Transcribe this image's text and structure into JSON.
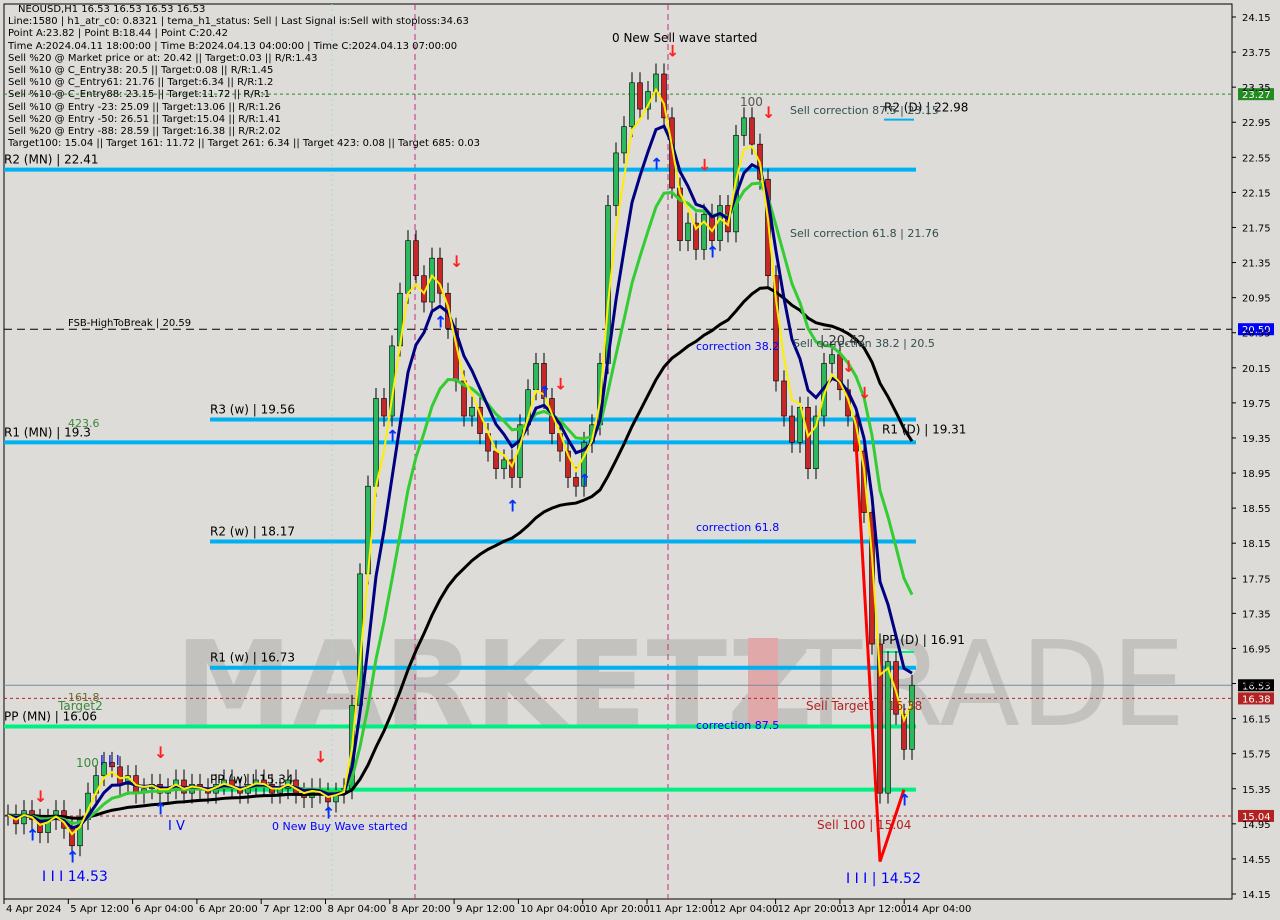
{
  "header": {
    "title": "NEOUSD,H1  16.53 16.53 16.53 16.53",
    "lines": [
      "Line:1580 | h1_atr_c0: 0.8321 | tema_h1_status: Sell | Last Signal is:Sell with stoploss:34.63",
      "Point A:23.82 | Point B:18.44 | Point C:20.42",
      "Time A:2024.04.11 18:00:00 | Time B:2024.04.13 04:00:00 | Time C:2024.04.13 07:00:00",
      "Sell %20 @ Market price or at: 20.42 || Target:0.03 || R/R:1.43",
      "Sell %10 @ C_Entry38: 20.5 || Target:0.08 || R/R:1.45",
      "Sell %10 @ C_Entry61: 21.76 || Target:6.34 || R/R:1.2",
      "Sell %10 @ C_Entry88: 23.15 || Target:11.72 || R/R:1",
      "Sell %10 @ Entry -23: 25.09 || Target:13.06 || R/R:1.26",
      "Sell %20 @ Entry -50: 26.51 || Target:15.04 || R/R:1.41",
      "Sell %20 @ Entry -88: 28.59 || Target:16.38 || R/R:2.02",
      "Target100: 15.04 || Target 161: 11.72 || Target 261: 6.34 || Target 423: 0.08 || Target 685: 0.03"
    ]
  },
  "watermark": {
    "left": "MARKETZ",
    "right": "TRADE"
  },
  "chart_data": {
    "type": "candlestick",
    "symbol": "NEOUSD",
    "timeframe": "H1",
    "ylim": [
      14.15,
      24.15
    ],
    "y_ticks": [
      "24.15",
      "23.75",
      "23.35",
      "22.95",
      "22.55",
      "22.15",
      "21.75",
      "21.35",
      "20.95",
      "20.55",
      "20.15",
      "19.75",
      "19.35",
      "18.95",
      "18.55",
      "18.15",
      "17.75",
      "17.35",
      "16.95",
      "16.55",
      "16.15",
      "15.75",
      "15.35",
      "14.95",
      "14.55",
      "14.15"
    ],
    "x_ticks": [
      "4 Apr 2024",
      "5 Apr 12:00",
      "6 Apr 04:00",
      "6 Apr 20:00",
      "7 Apr 12:00",
      "8 Apr 04:00",
      "8 Apr 20:00",
      "9 Apr 12:00",
      "10 Apr 04:00",
      "10 Apr 20:00",
      "11 Apr 12:00",
      "12 Apr 04:00",
      "12 Apr 20:00",
      "13 Apr 12:00",
      "14 Apr 04:00"
    ],
    "closes": [
      15.05,
      14.95,
      15.1,
      15.0,
      14.85,
      15.0,
      15.1,
      14.9,
      14.7,
      15.0,
      15.3,
      15.5,
      15.65,
      15.6,
      15.4,
      15.5,
      15.3,
      15.35,
      15.4,
      15.3,
      15.35,
      15.45,
      15.3,
      15.4,
      15.35,
      15.3,
      15.4,
      15.45,
      15.35,
      15.3,
      15.4,
      15.45,
      15.4,
      15.3,
      15.35,
      15.45,
      15.3,
      15.25,
      15.35,
      15.3,
      15.2,
      15.3,
      15.35,
      16.3,
      17.8,
      18.8,
      19.8,
      19.6,
      20.4,
      21.0,
      21.6,
      21.2,
      20.9,
      21.4,
      21.0,
      20.6,
      20.0,
      19.6,
      19.7,
      19.4,
      19.2,
      19.0,
      19.1,
      18.9,
      19.5,
      19.9,
      20.2,
      19.8,
      19.4,
      19.2,
      18.9,
      18.8,
      19.3,
      19.5,
      20.2,
      22.0,
      22.6,
      22.9,
      23.4,
      23.1,
      23.3,
      23.5,
      23.0,
      22.2,
      21.6,
      21.8,
      21.5,
      21.9,
      21.6,
      22.0,
      21.7,
      22.8,
      23.0,
      22.7,
      22.3,
      21.2,
      20.0,
      19.6,
      19.3,
      19.7,
      19.0,
      19.6,
      20.2,
      20.3,
      19.9,
      19.6,
      19.2,
      18.5,
      17.0,
      15.3,
      16.8,
      16.2,
      15.8,
      16.53
    ],
    "up_color": "#2eb85c",
    "down_color": "#c62828",
    "ma_colors": {
      "fast": "#ffee00",
      "mid": "#000080",
      "slow": "#33cc33",
      "long": "#000000"
    },
    "levels": [
      {
        "label": "R2 (MN) | 22.41",
        "price": 22.41,
        "color": "#00b0f0"
      },
      {
        "label": "R3 (w) | 19.56",
        "price": 19.56,
        "color": "#00b0f0"
      },
      {
        "label": "R1 (MN) | 19.3",
        "price": 19.3,
        "color": "#00b0f0"
      },
      {
        "label": "R2 (w) | 18.17",
        "price": 18.17,
        "color": "#00b0f0"
      },
      {
        "label": "R1 (w) | 16.73",
        "price": 16.73,
        "color": "#00b0f0"
      },
      {
        "label": "PP (MN) | 16.06",
        "price": 16.06,
        "color": "#00f080"
      },
      {
        "label": "PP (w) | 15.34",
        "price": 15.34,
        "color": "#00f080"
      },
      {
        "label": "PP (D) | 16.91",
        "price": 16.91,
        "color": "#00f080"
      },
      {
        "label": "R1 (D) | 19.31",
        "price": 19.31,
        "color": "#00b0f0"
      },
      {
        "label": "R2 (D) | 22.98",
        "price": 22.98,
        "color": "#00b0f0"
      }
    ],
    "hlines": [
      {
        "label": "FSB-HighToBreak | 20.59",
        "price": 20.59,
        "color": "#000000",
        "axis_label": "20.59",
        "axis_bg": "#0000ff"
      },
      {
        "label": "",
        "price": 23.27,
        "color": "#228b22",
        "axis_label": "23.27",
        "axis_bg": "#228b22"
      },
      {
        "label": "",
        "price": 16.53,
        "color": "#7a8aa0",
        "axis_label": "16.53",
        "axis_bg": "#000000"
      },
      {
        "label": "",
        "price": 16.38,
        "color": "#b22222",
        "axis_label": "16.38",
        "axis_bg": "#b22222"
      },
      {
        "label": "",
        "price": 15.04,
        "color": "#b22222",
        "axis_label": "15.04",
        "axis_bg": "#b22222"
      }
    ],
    "annotations": [
      {
        "text": "0 New Sell wave started",
        "color": "#000000"
      },
      {
        "text": "0 New Buy Wave started",
        "color": "#0000ff"
      },
      {
        "text": "correction 38.2",
        "color": "#0000ff"
      },
      {
        "text": "correction 61.8",
        "color": "#0000ff"
      },
      {
        "text": "correction 87.5",
        "color": "#0000ff"
      },
      {
        "text": "Sell correction 87.5 | 23.15",
        "color": "#2f4f4f"
      },
      {
        "text": "Sell correction 61.8 | 21.76",
        "color": "#2f4f4f"
      },
      {
        "text": "Sell correction 38.2 | 20.5",
        "color": "#2f4f4f"
      },
      {
        "text": "Sell Target1 | 16.38",
        "color": "#b22222"
      },
      {
        "text": "Sell 100 | 15.04",
        "color": "#b22222"
      },
      {
        "text": "I I I | 14.52",
        "color": "#0000ff"
      },
      {
        "text": "I I I 14.53",
        "color": "#0000ff"
      },
      {
        "text": "I V",
        "color": "#0000ff"
      },
      {
        "text": "I I I",
        "color": "#0000ff"
      },
      {
        "text": "100",
        "color": "#3a8a3a"
      },
      {
        "text": "100",
        "color": "#555555"
      },
      {
        "text": "423.6",
        "color": "#3a8a3a"
      },
      {
        "text": "161.8",
        "color": "#6b6b2f"
      },
      {
        "text": "Target2",
        "color": "#3a8a3a"
      },
      {
        "text": "| 20.42",
        "color": "#333333"
      }
    ],
    "signals": [
      {
        "type": "buy",
        "i": 8,
        "price": 14.6
      },
      {
        "type": "buy",
        "i": 3,
        "price": 14.85
      },
      {
        "type": "sell",
        "i": 4,
        "price": 15.2
      },
      {
        "type": "sell",
        "i": 19,
        "price": 15.7
      },
      {
        "type": "buy",
        "i": 19,
        "price": 15.15
      },
      {
        "type": "sell",
        "i": 39,
        "price": 15.65
      },
      {
        "type": "buy",
        "i": 40,
        "price": 15.1
      },
      {
        "type": "buy",
        "i": 48,
        "price": 19.4
      },
      {
        "type": "buy",
        "i": 54,
        "price": 20.7
      },
      {
        "type": "sell",
        "i": 56,
        "price": 21.3
      },
      {
        "type": "buy",
        "i": 63,
        "price": 18.6
      },
      {
        "type": "buy",
        "i": 67,
        "price": 19.9
      },
      {
        "type": "sell",
        "i": 69,
        "price": 19.9
      },
      {
        "type": "buy",
        "i": 72,
        "price": 18.9
      },
      {
        "type": "buy",
        "i": 81,
        "price": 22.5
      },
      {
        "type": "sell",
        "i": 83,
        "price": 23.7
      },
      {
        "type": "sell",
        "i": 87,
        "price": 22.4
      },
      {
        "type": "buy",
        "i": 88,
        "price": 21.5
      },
      {
        "type": "sell",
        "i": 95,
        "price": 23.0
      },
      {
        "type": "sell",
        "i": 105,
        "price": 20.1
      },
      {
        "type": "sell",
        "i": 107,
        "price": 19.8
      },
      {
        "type": "buy",
        "i": 112,
        "price": 15.25
      }
    ],
    "zigzag": [
      {
        "i": 106,
        "price": 19.3
      },
      {
        "i": 109,
        "price": 14.52
      },
      {
        "i": 112,
        "price": 15.34
      }
    ]
  }
}
